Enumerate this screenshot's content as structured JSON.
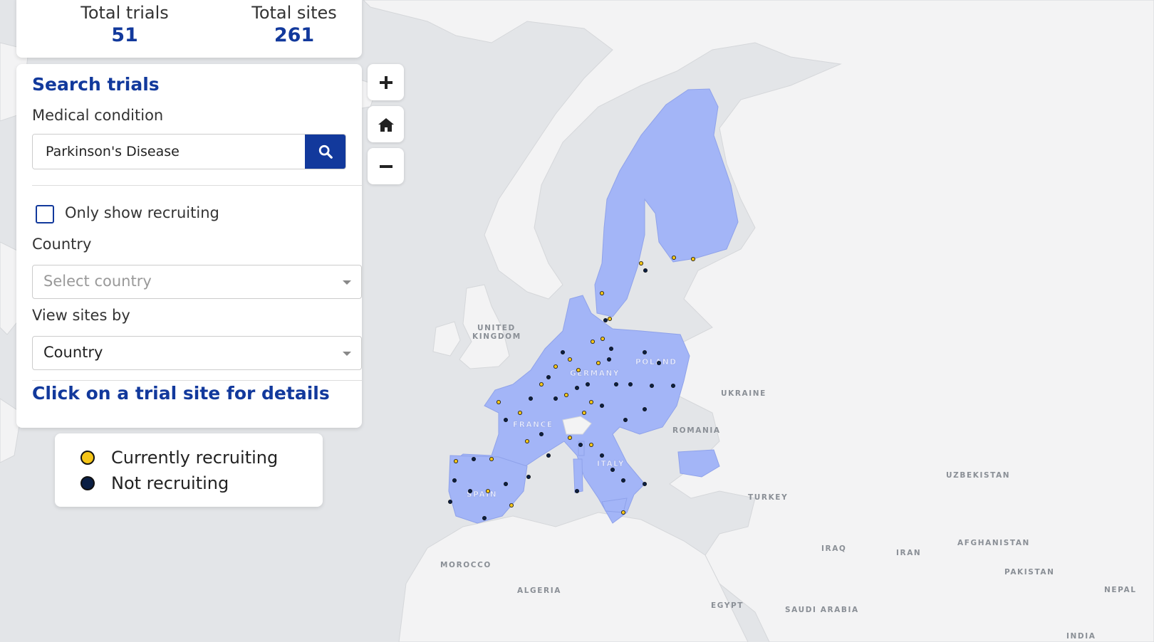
{
  "stats": {
    "total_trials_label": "Total trials",
    "total_trials_value": "51",
    "total_sites_label": "Total sites",
    "total_sites_value": "261"
  },
  "search": {
    "title": "Search trials",
    "medical_condition_label": "Medical condition",
    "medical_condition_value": "Parkinson's Disease",
    "only_recruiting_label": "Only show recruiting",
    "only_recruiting_checked": false,
    "country_label": "Country",
    "country_placeholder": "Select country",
    "view_sites_label": "View sites by",
    "view_sites_value": "Country",
    "hint": "Click on a trial site for details"
  },
  "legend": {
    "recruiting_label": "Currently recruiting",
    "recruiting_color": "#f5c518",
    "not_recruiting_label": "Not recruiting",
    "not_recruiting_color": "#0b1f44"
  },
  "map_controls": {
    "zoom_in_icon": "plus-icon",
    "home_icon": "home-icon",
    "zoom_out_icon": "minus-icon"
  },
  "map_labels": {
    "uk_line1": "UNITED",
    "uk_line2": "KINGDOM",
    "germany": "GERMANY",
    "poland": "POLAND",
    "france": "FRANCE",
    "ukraine": "UKRAINE",
    "romania": "ROMANIA",
    "italy": "ITALY",
    "spain": "SPAIN",
    "turkey": "TURKEY",
    "uzbekistan": "UZBEKISTAN",
    "morocco": "MOROCCO",
    "algeria": "ALGERIA",
    "iraq": "IRAQ",
    "iran": "IRAN",
    "afghanistan": "AFGHANISTAN",
    "pakistan": "PAKISTAN",
    "egypt": "EGYPT",
    "saudi_arabia": "SAUDI ARABIA",
    "nepal": "NEPAL",
    "india": "INDIA"
  },
  "colors": {
    "eu_fill": "#a3b5f7",
    "land_fill": "#f3f3f4",
    "sea_fill": "#e3e5e8",
    "accent": "#12399c"
  }
}
